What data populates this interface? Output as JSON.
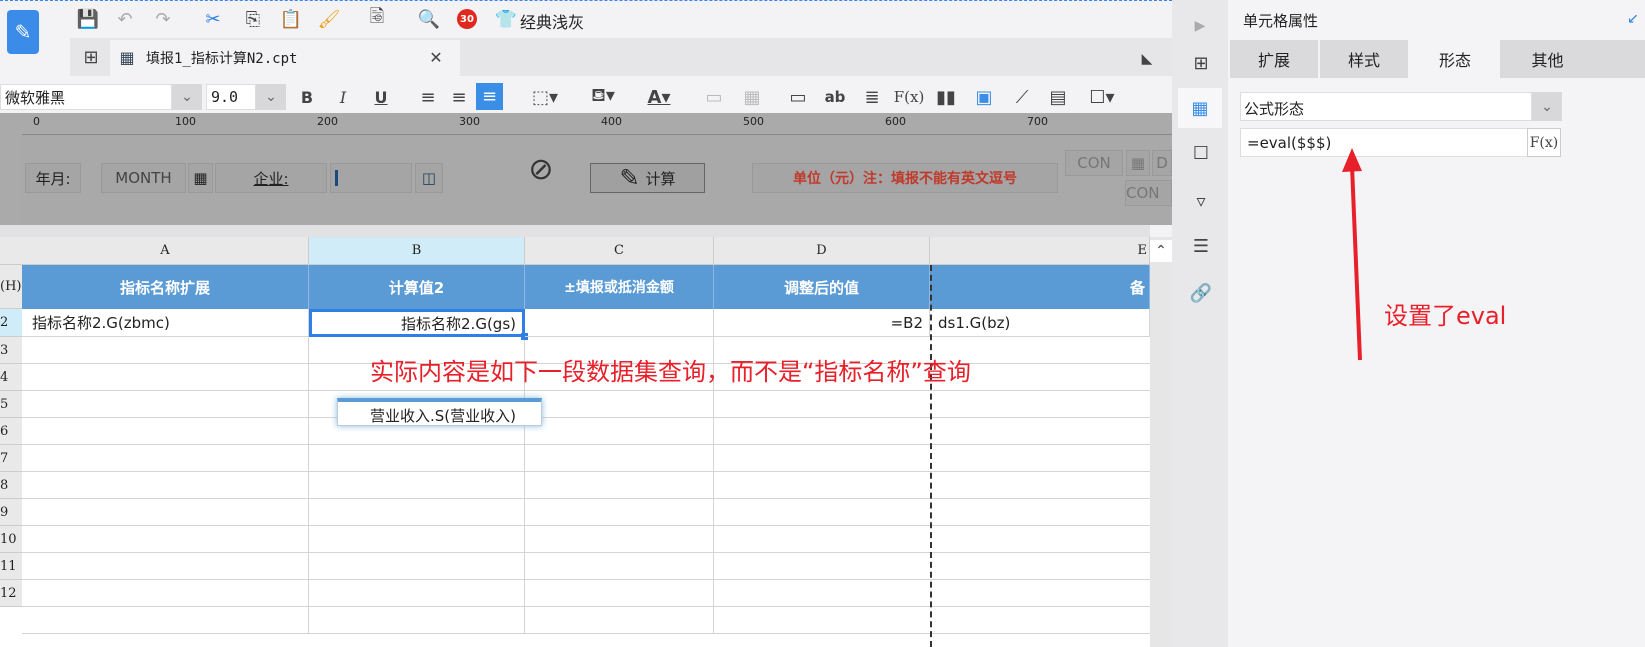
{
  "toolbar": {
    "theme_label": "经典浅灰",
    "badge": "30"
  },
  "tab": {
    "title": "填报1_指标计算N2.cpt"
  },
  "format": {
    "font": "微软雅黑",
    "size": "9.0"
  },
  "ruler": {
    "ticks": [
      "0",
      "100",
      "200",
      "300",
      "400",
      "500",
      "600",
      "700"
    ]
  },
  "form": {
    "year_month_label": "年月:",
    "month_param": "MONTH",
    "company_label": "企业:",
    "calc_button": "计算",
    "note": "单位（元）注：填报不能有英文逗号",
    "con1": "CON",
    "con2": "CON",
    "d_param": "D"
  },
  "grid": {
    "columns": [
      "A",
      "B",
      "C",
      "D",
      "E"
    ],
    "row_numbers": [
      "(H)",
      "2",
      "3",
      "4",
      "5",
      "6",
      "7",
      "8",
      "9",
      "10",
      "11",
      "12"
    ],
    "headers": [
      "指标名称扩展",
      "计算值2",
      "±填报或抵消金额",
      "调整后的值",
      "备"
    ],
    "row2": [
      "指标名称2.G(zbmc)",
      "指标名称2.G(gs)",
      "",
      "=B2",
      "ds1.G(bz)"
    ],
    "popup_item": "营业收入.S(营业收入)"
  },
  "panel": {
    "title": "单元格属性",
    "tabs": [
      "扩展",
      "样式",
      "形态",
      "其他"
    ],
    "active_tab": "形态",
    "form_type": "公式形态",
    "formula": "=eval($$$)"
  },
  "annotations": {
    "main": "实际内容是如下一段数据集查询，而不是“指标名称”查询",
    "side": "设置了eval"
  },
  "colors": {
    "header_blue": "#5b9bd5",
    "accent": "#2f7fe6",
    "annotation_red": "#e8202a"
  }
}
